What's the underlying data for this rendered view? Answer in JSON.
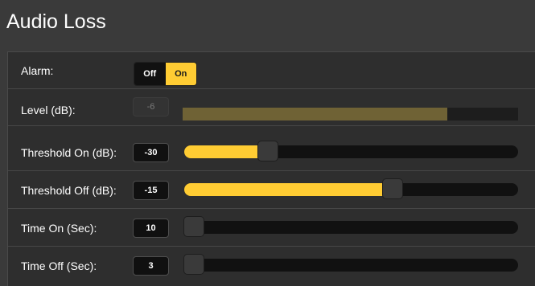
{
  "title": "Audio Loss",
  "colors": {
    "accent": "#ffcc33",
    "level_fill": "#6f6235"
  },
  "alarm": {
    "label": "Alarm:",
    "off_label": "Off",
    "on_label": "On",
    "selected": "On"
  },
  "level": {
    "label": "Level (dB):",
    "value": "-6",
    "fill_fraction": 0.79
  },
  "sliders": [
    {
      "key": "threshold_on",
      "label": "Threshold On (dB):",
      "value": "-30",
      "position": 0.25
    },
    {
      "key": "threshold_off",
      "label": "Threshold Off (dB):",
      "value": "-15",
      "position": 0.625
    },
    {
      "key": "time_on",
      "label": "Time On (Sec):",
      "value": "10",
      "position": 0.0
    },
    {
      "key": "time_off",
      "label": "Time Off (Sec):",
      "value": "3",
      "position": 0.0
    }
  ]
}
